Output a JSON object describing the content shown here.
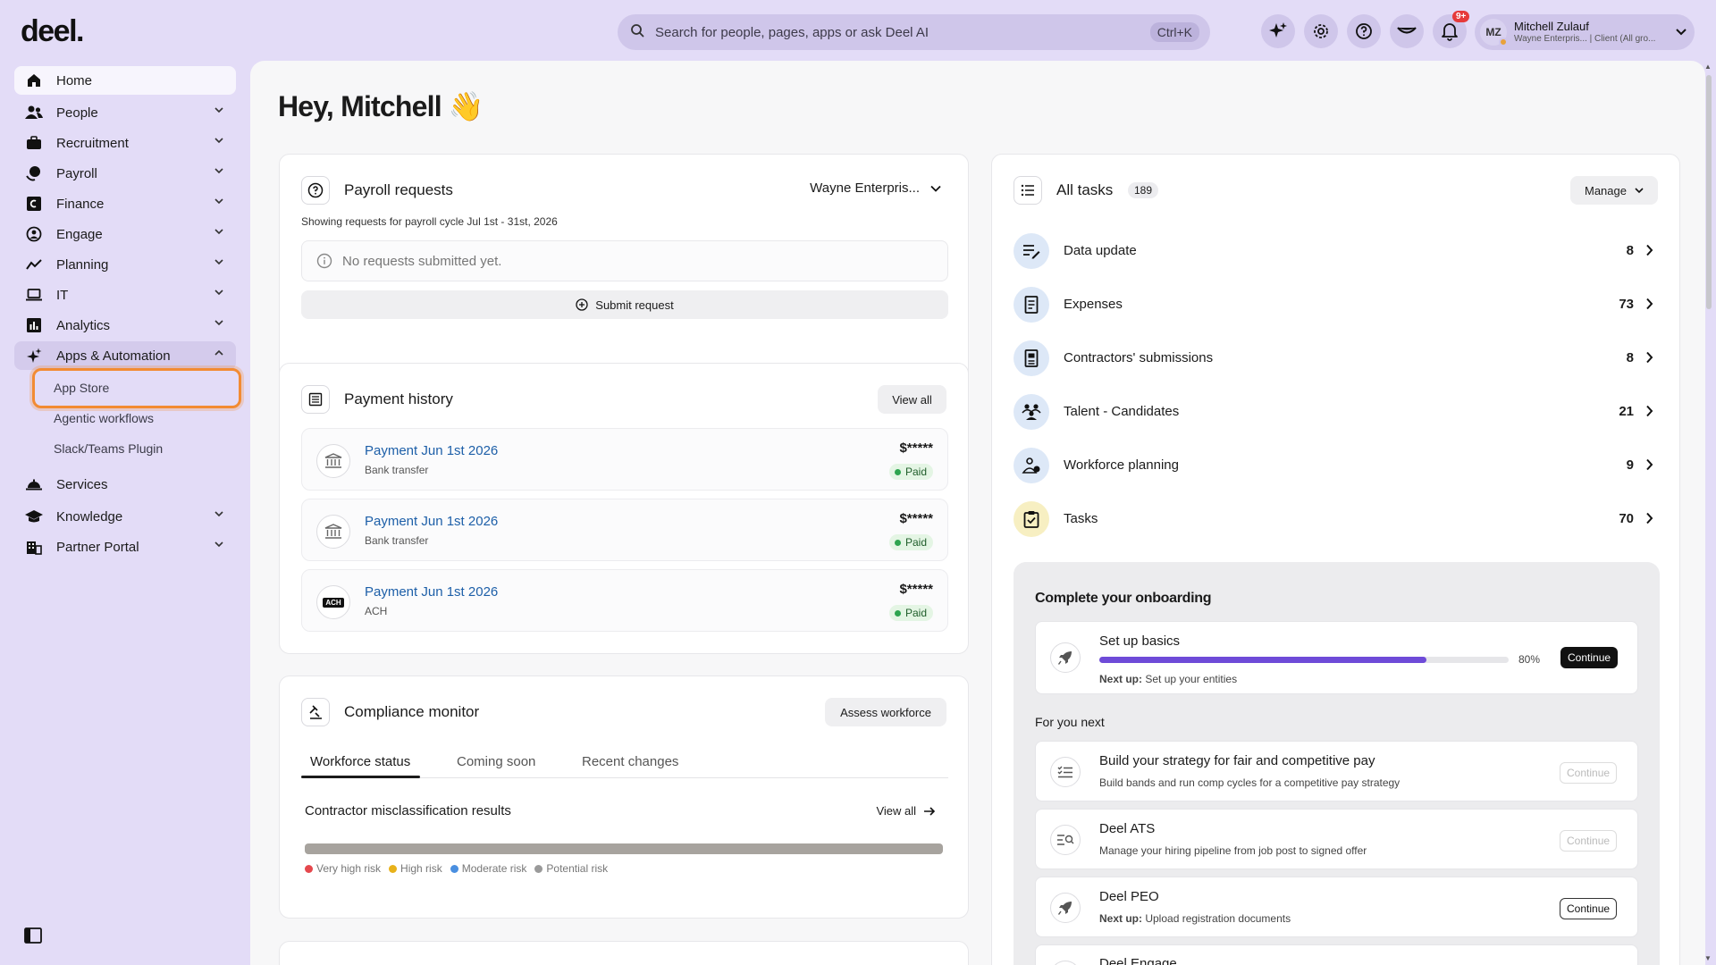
{
  "app": {
    "logo": "deel."
  },
  "topbar": {
    "search_placeholder": "Search for people, pages, apps or ask Deel AI",
    "search_shortcut": "Ctrl+K",
    "notifications_badge": "9+",
    "user": {
      "initials": "MZ",
      "name": "Mitchell Zulauf",
      "subtitle": "Wayne Enterpris... | Client (All gro..."
    }
  },
  "sidebar": {
    "items": [
      {
        "label": "Home",
        "icon": "home-icon"
      },
      {
        "label": "People",
        "icon": "people-icon"
      },
      {
        "label": "Recruitment",
        "icon": "briefcase-icon"
      },
      {
        "label": "Payroll",
        "icon": "payroll-icon"
      },
      {
        "label": "Finance",
        "icon": "finance-icon"
      },
      {
        "label": "Engage",
        "icon": "engage-icon"
      },
      {
        "label": "Planning",
        "icon": "trend-line-icon"
      },
      {
        "label": "IT",
        "icon": "laptop-icon"
      },
      {
        "label": "Analytics",
        "icon": "bar-chart-icon"
      },
      {
        "label": "Apps & Automation",
        "icon": "sparkle-icon"
      },
      {
        "label": "Services",
        "icon": "bell-service-icon"
      },
      {
        "label": "Knowledge",
        "icon": "graduation-cap-icon"
      },
      {
        "label": "Partner Portal",
        "icon": "building-icon"
      }
    ],
    "sub_items": [
      "App Store",
      "Agentic workflows",
      "Slack/Teams Plugin"
    ]
  },
  "main": {
    "greeting": "Hey, Mitchell 👋",
    "payroll_requests": {
      "title": "Payroll requests",
      "entity": "Wayne Enterpris...",
      "cycle_text": "Showing requests for payroll cycle Jul 1st - 31st, 2026",
      "empty_text": "No requests submitted yet.",
      "submit_label": "Submit request"
    },
    "payment_history": {
      "title": "Payment history",
      "view_all": "View all",
      "rows": [
        {
          "title": "Payment Jun 1st 2026",
          "method": "Bank transfer",
          "amount": "$*****",
          "status": "Paid"
        },
        {
          "title": "Payment Jun 1st 2026",
          "method": "Bank transfer",
          "amount": "$*****",
          "status": "Paid"
        },
        {
          "title": "Payment Jun 1st 2026",
          "method": "ACH",
          "amount": "$*****",
          "status": "Paid"
        }
      ],
      "ach_label": "ACH"
    },
    "compliance": {
      "title": "Compliance monitor",
      "assess_label": "Assess workforce",
      "tabs": [
        "Workforce status",
        "Coming soon",
        "Recent changes"
      ],
      "results_title": "Contractor misclassification results",
      "view_all": "View all",
      "legend": [
        {
          "label": "Very high risk",
          "color": "#e5484d"
        },
        {
          "label": "High risk",
          "color": "#e8b21a"
        },
        {
          "label": "Moderate risk",
          "color": "#4a8fe0"
        },
        {
          "label": "Potential risk",
          "color": "#9a9a9a"
        }
      ]
    },
    "tasks": {
      "title": "All tasks",
      "count": "189",
      "manage_label": "Manage",
      "items": [
        {
          "label": "Data update",
          "count": "8"
        },
        {
          "label": "Expenses",
          "count": "73"
        },
        {
          "label": "Contractors' submissions",
          "count": "8"
        },
        {
          "label": "Talent - Candidates",
          "count": "21"
        },
        {
          "label": "Workforce planning",
          "count": "9"
        },
        {
          "label": "Tasks",
          "count": "70"
        }
      ]
    },
    "onboarding": {
      "title": "Complete your onboarding",
      "setup": {
        "title": "Set up basics",
        "progress": 80,
        "progress_label": "80%",
        "next_prefix": "Next up:",
        "next_text": "Set up your entities",
        "button": "Continue"
      },
      "for_you_next": "For you next",
      "cards": [
        {
          "title": "Build your strategy for fair and competitive pay",
          "subtitle": "Build bands and run comp cycles for a competitive pay strategy",
          "button": "Continue"
        },
        {
          "title": "Deel ATS",
          "subtitle": "Manage your hiring pipeline from job post to signed offer",
          "button": "Continue"
        },
        {
          "title": "Deel PEO",
          "next_prefix": "Next up:",
          "subtitle": "Upload registration documents",
          "button": "Continue"
        },
        {
          "title": "Deel Engage"
        }
      ]
    }
  },
  "colors": {
    "accent": "#6e4bd8",
    "background": "#e3dcf7",
    "highlight": "#f28b33"
  }
}
